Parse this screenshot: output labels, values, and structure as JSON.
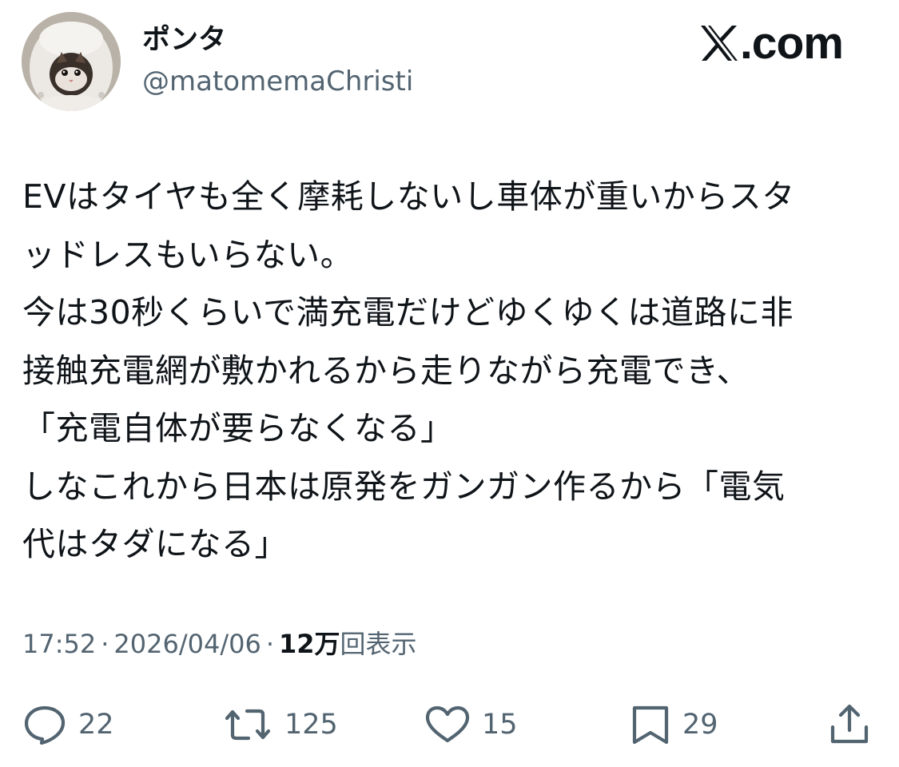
{
  "user": {
    "display_name": "ポンタ",
    "handle": "@matomemaChristi"
  },
  "brand": {
    "text": ".com"
  },
  "tweet": {
    "lines": [
      "EVはタイヤも全く摩耗しないし車体が重いからスタ",
      "ッドレスもいらない。",
      "今は30秒くらいで満充電だけどゆくゆくは道路に非",
      "接触充電網が敷かれるから走りながら充電でき、",
      "「充電自体が要らなくなる」",
      "しなこれから日本は原発をガンガン作るから「電気",
      "代はタダになる」"
    ]
  },
  "meta": {
    "time": "17:52",
    "separator": "·",
    "date": "2026/04/06",
    "views_count": "12万",
    "views_label": "回表示"
  },
  "actions": {
    "replies": "22",
    "reposts": "125",
    "likes": "15",
    "bookmarks": "29"
  },
  "icons": {
    "reply": "speech-bubble-icon",
    "repost": "repost-arrows-icon",
    "like": "heart-icon",
    "bookmark": "bookmark-icon",
    "share": "share-upload-icon"
  },
  "colors": {
    "text": "#0f1419",
    "secondary": "#536471",
    "background": "#ffffff"
  }
}
